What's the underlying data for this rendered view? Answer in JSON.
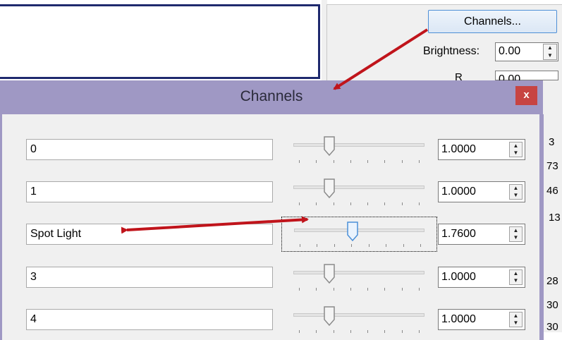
{
  "background": {
    "channels_button_label": "Channels...",
    "brightness_label": "Brightness:",
    "brightness_value": "0.00",
    "partial_label": "R",
    "partial_value": "0.00",
    "peek_values": [
      "3",
      "73",
      "46",
      "13",
      "28",
      "30",
      "30"
    ]
  },
  "dialog": {
    "title": "Channels",
    "close_label": "x",
    "rows": [
      {
        "name": "0",
        "value": "1.0000",
        "slider_fraction": 0.25,
        "focused": false
      },
      {
        "name": "1",
        "value": "1.0000",
        "slider_fraction": 0.25,
        "focused": false
      },
      {
        "name": "Spot Light",
        "value": "1.7600",
        "slider_fraction": 0.44,
        "focused": true
      },
      {
        "name": "3",
        "value": "1.0000",
        "slider_fraction": 0.25,
        "focused": false
      },
      {
        "name": "4",
        "value": "1.0000",
        "slider_fraction": 0.25,
        "focused": false
      }
    ]
  },
  "colors": {
    "dialog_title_bg": "#9f98c4",
    "close_button": "#c74442",
    "annotation_arrow": "#c0141b",
    "focused_thumb": "#4a8fd8"
  },
  "icons": {
    "spin_up": "spin-up-icon",
    "spin_down": "spin-down-icon",
    "close": "close-icon"
  }
}
